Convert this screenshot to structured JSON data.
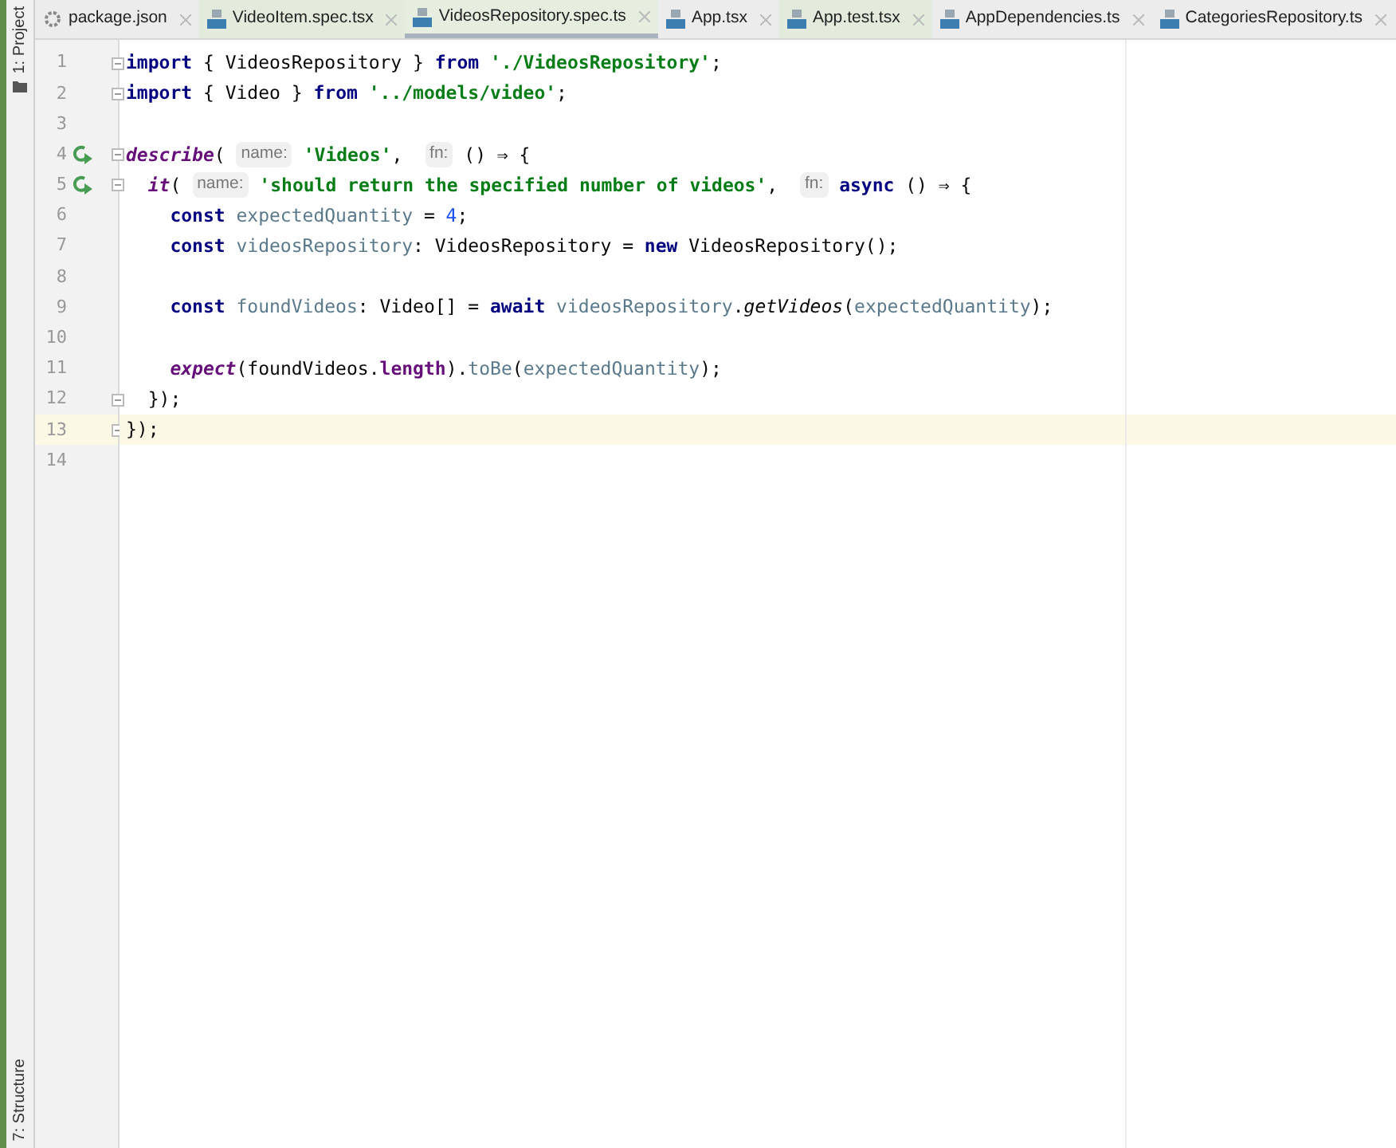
{
  "side_panels": [
    {
      "label": "1: Project"
    },
    {
      "label": "7: Structure"
    }
  ],
  "tabs": [
    {
      "label": "package.json",
      "kind": "json",
      "test_file": false,
      "selected": false
    },
    {
      "label": "VideoItem.spec.tsx",
      "kind": "tsx",
      "test_file": true,
      "selected": false
    },
    {
      "label": "VideosRepository.spec.ts",
      "kind": "ts",
      "test_file": true,
      "selected": true
    },
    {
      "label": "App.tsx",
      "kind": "tsx",
      "test_file": false,
      "selected": false
    },
    {
      "label": "App.test.tsx",
      "kind": "tsx",
      "test_file": true,
      "selected": false
    },
    {
      "label": "AppDependencies.ts",
      "kind": "ts",
      "test_file": false,
      "selected": false
    },
    {
      "label": "CategoriesRepository.ts",
      "kind": "ts",
      "test_file": false,
      "selected": false
    }
  ],
  "lines": [
    {
      "number": "1",
      "run": false,
      "fold": true,
      "current": false,
      "tokens": [
        {
          "kind": "kw",
          "text": "import"
        },
        {
          "kind": "plain",
          "text": " { VideosRepository } "
        },
        {
          "kind": "kw",
          "text": "from"
        },
        {
          "kind": "str",
          "text": " './VideosRepository'"
        },
        {
          "kind": "plain",
          "text": ";"
        }
      ]
    },
    {
      "number": "2",
      "run": false,
      "fold": true,
      "current": false,
      "tokens": [
        {
          "kind": "kw",
          "text": "import"
        },
        {
          "kind": "plain",
          "text": " { Video } "
        },
        {
          "kind": "kw",
          "text": "from"
        },
        {
          "kind": "str",
          "text": " '../models/video'"
        },
        {
          "kind": "plain",
          "text": ";"
        }
      ]
    },
    {
      "number": "3",
      "run": false,
      "fold": false,
      "current": false
    },
    {
      "number": "4",
      "run": true,
      "fold": true,
      "current": false,
      "tokens": [
        {
          "kind": "fn",
          "text": "describe"
        },
        {
          "kind": "plain",
          "text": "( "
        },
        {
          "kind": "hint",
          "text": "name:"
        },
        {
          "kind": "str",
          "text": " 'Videos'"
        },
        {
          "kind": "plain",
          "text": ",  "
        },
        {
          "kind": "hint",
          "text": "fn:"
        },
        {
          "kind": "plain",
          "text": " () ⇒ {"
        }
      ]
    },
    {
      "number": "5",
      "run": true,
      "fold": true,
      "current": false,
      "tokens": [
        {
          "kind": "fn",
          "text": "  it"
        },
        {
          "kind": "plain",
          "text": "( "
        },
        {
          "kind": "hint",
          "text": "name:"
        },
        {
          "kind": "str",
          "text": " 'should return the specified number of videos'"
        },
        {
          "kind": "plain",
          "text": ",  "
        },
        {
          "kind": "hint",
          "text": "fn:"
        },
        {
          "kind": "kw",
          "text": " async"
        },
        {
          "kind": "plain",
          "text": " () ⇒ {"
        }
      ]
    },
    {
      "number": "6",
      "run": false,
      "fold": false,
      "current": false,
      "tokens": [
        {
          "kind": "kw",
          "text": "    const"
        },
        {
          "kind": "local",
          "text": " expectedQuantity"
        },
        {
          "kind": "plain",
          "text": " = "
        },
        {
          "kind": "num",
          "text": "4"
        },
        {
          "kind": "plain",
          "text": ";"
        }
      ]
    },
    {
      "number": "7",
      "run": false,
      "fold": false,
      "current": false,
      "tokens": [
        {
          "kind": "kw",
          "text": "    const"
        },
        {
          "kind": "local",
          "text": " videosRepository"
        },
        {
          "kind": "plain",
          "text": ": VideosRepository = "
        },
        {
          "kind": "kw",
          "text": "new"
        },
        {
          "kind": "plain",
          "text": " VideosRepository();"
        }
      ]
    },
    {
      "number": "8",
      "run": false,
      "fold": false,
      "current": false
    },
    {
      "number": "9",
      "run": false,
      "fold": false,
      "current": false,
      "tokens": [
        {
          "kind": "kw",
          "text": "    const"
        },
        {
          "kind": "local",
          "text": " foundVideos"
        },
        {
          "kind": "plain",
          "text": ": Video[] = "
        },
        {
          "kind": "kw",
          "text": "await"
        },
        {
          "kind": "local",
          "text": " videosRepository"
        },
        {
          "kind": "plain",
          "text": "."
        },
        {
          "kind": "method",
          "text": "getVideos"
        },
        {
          "kind": "plain",
          "text": "("
        },
        {
          "kind": "local",
          "text": "expectedQuantity"
        },
        {
          "kind": "plain",
          "text": ");"
        }
      ]
    },
    {
      "number": "10",
      "run": false,
      "fold": false,
      "current": false
    },
    {
      "number": "11",
      "run": false,
      "fold": false,
      "current": false,
      "tokens": [
        {
          "kind": "fn",
          "text": "    expect"
        },
        {
          "kind": "plain",
          "text": "(foundVideos."
        },
        {
          "kind": "prop",
          "text": "length"
        },
        {
          "kind": "plain",
          "text": ")."
        },
        {
          "kind": "local",
          "text": "toBe"
        },
        {
          "kind": "plain",
          "text": "("
        },
        {
          "kind": "local",
          "text": "expectedQuantity"
        },
        {
          "kind": "plain",
          "text": ");"
        }
      ]
    },
    {
      "number": "12",
      "run": false,
      "fold": true,
      "current": false,
      "tokens": [
        {
          "kind": "plain",
          "text": "  });"
        }
      ]
    },
    {
      "number": "13",
      "run": false,
      "fold": true,
      "current": true,
      "tokens": [
        {
          "kind": "plain",
          "text": "});"
        }
      ]
    },
    {
      "number": "14",
      "run": false,
      "fold": false,
      "current": false
    }
  ]
}
